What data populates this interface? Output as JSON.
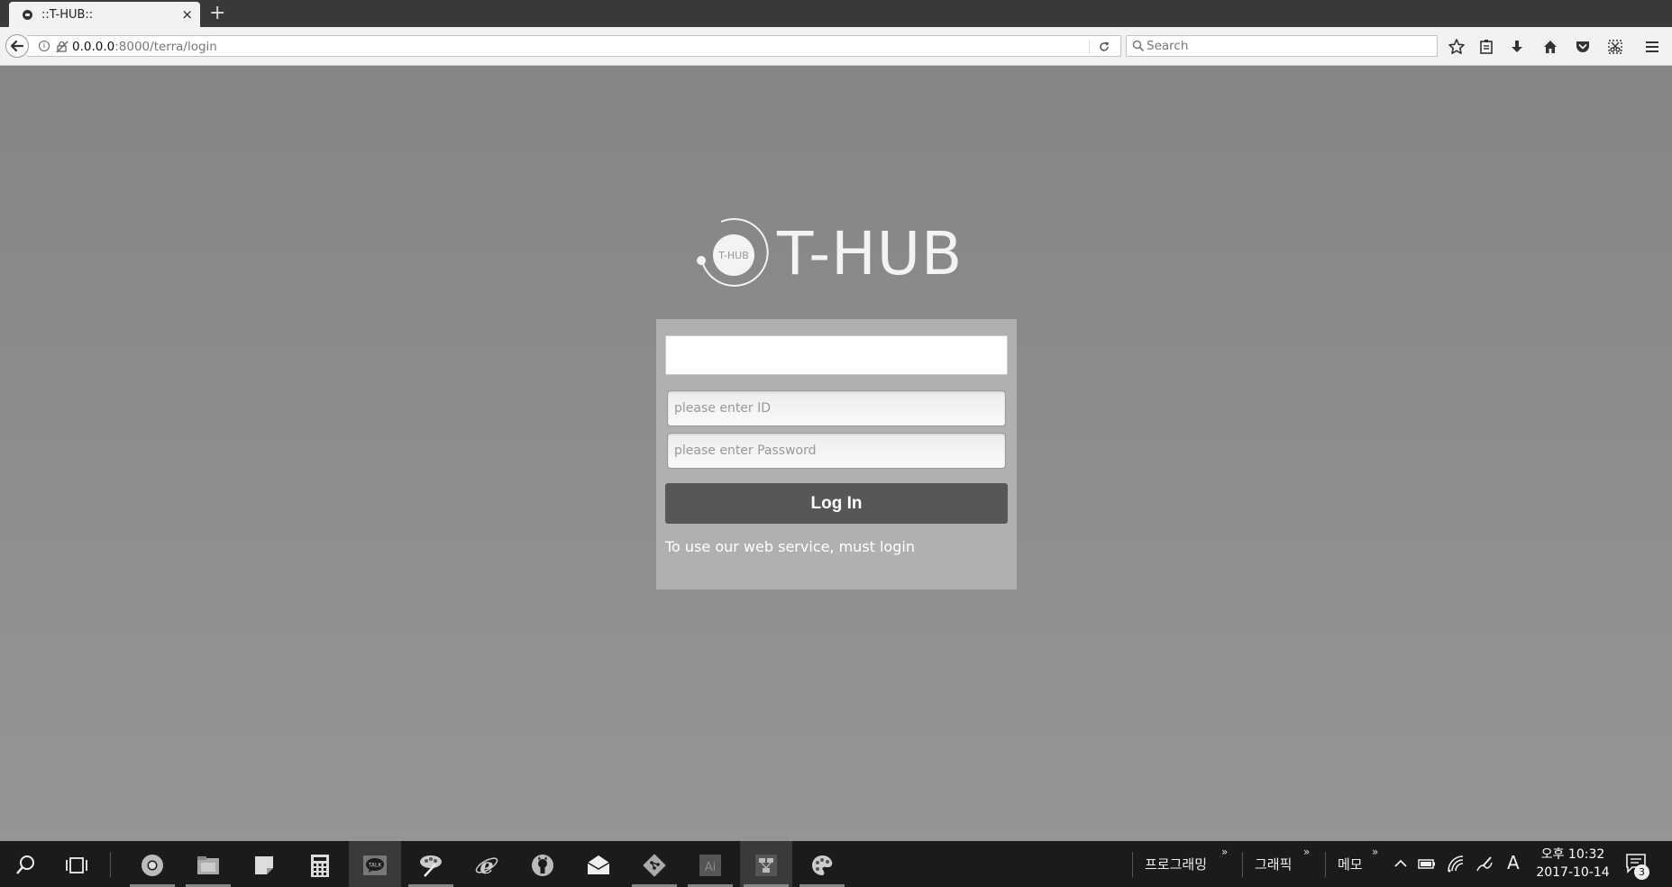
{
  "browser": {
    "tab": {
      "title": "::T-HUB::",
      "close_label": "×"
    },
    "new_tab_label": "+",
    "url": {
      "host": "0.0.0.0",
      "rest": ":8000/terra/login"
    },
    "search": {
      "placeholder": "Search"
    }
  },
  "page": {
    "logo": {
      "mark_text": "T-HUB",
      "wordmark": "T-HUB"
    },
    "login": {
      "id_placeholder": "please enter ID",
      "password_placeholder": "please enter Password",
      "button_label": "Log In",
      "note": "To use our web service, must login"
    }
  },
  "taskbar": {
    "toolbars": [
      {
        "label": "프로그래밍"
      },
      {
        "label": "그래픽"
      },
      {
        "label": "메모"
      }
    ],
    "chevron": "»",
    "ime_label": "A",
    "clock": {
      "time": "오후 10:32",
      "date": "2017-10-14"
    },
    "notification_count": "3"
  },
  "colors": {
    "page_background": "#8a8a8a",
    "panel_background": "#b0b0b0",
    "button_background": "#575757",
    "taskbar_background": "#1b1b1b"
  }
}
